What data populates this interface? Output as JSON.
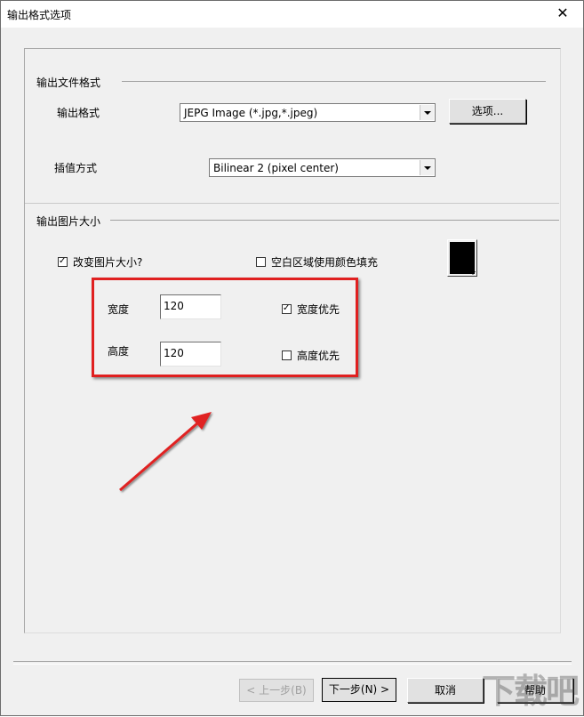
{
  "window": {
    "title": "输出格式选项",
    "close_glyph": "✕"
  },
  "output_format_group": {
    "title": "输出文件格式",
    "format_label": "输出格式",
    "format_value": "JEPG Image (*.jpg,*.jpeg)",
    "options_button": "选项...",
    "interp_label": "插值方式",
    "interp_value": "Bilinear 2 (pixel center)"
  },
  "output_size_group": {
    "title": "输出图片大小",
    "resize_checkbox": {
      "label": "改变图片大小?",
      "checked": true
    },
    "fill_checkbox": {
      "label": "空白区域使用颜色填充",
      "checked": false
    },
    "fill_color": "#000000",
    "width_label": "宽度",
    "width_value": "120",
    "height_label": "高度",
    "height_value": "120",
    "width_priority": {
      "label": "宽度优先",
      "checked": true
    },
    "height_priority": {
      "label": "高度优先",
      "checked": false
    }
  },
  "annotation": {
    "color": "#e02020"
  },
  "footer": {
    "prev_button": "< 上一步(B)",
    "next_button": "下一步(N) >",
    "cancel_button": "取消",
    "help_button": "帮助"
  },
  "watermark": {
    "text": "下载吧"
  }
}
